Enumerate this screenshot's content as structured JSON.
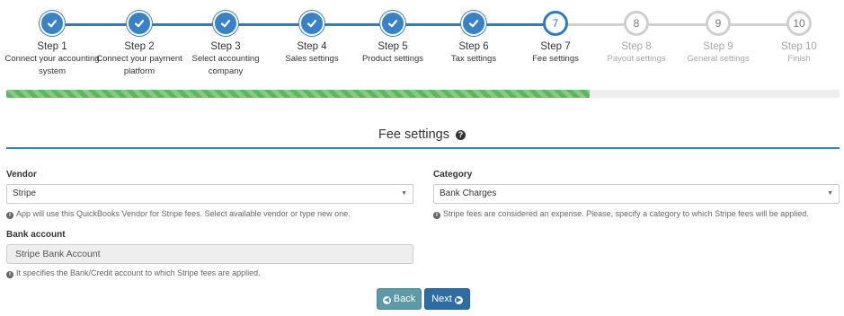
{
  "wizard": {
    "steps": [
      {
        "number": "1",
        "title": "Step 1",
        "desc": "Connect your accounting system",
        "status": "done"
      },
      {
        "number": "2",
        "title": "Step 2",
        "desc": "Connect your payment platform",
        "status": "done"
      },
      {
        "number": "3",
        "title": "Step 3",
        "desc": "Select accounting company",
        "status": "done"
      },
      {
        "number": "4",
        "title": "Step 4",
        "desc": "Sales settings",
        "status": "done"
      },
      {
        "number": "5",
        "title": "Step 5",
        "desc": "Product settings",
        "status": "done"
      },
      {
        "number": "6",
        "title": "Step 6",
        "desc": "Tax settings",
        "status": "done"
      },
      {
        "number": "7",
        "title": "Step 7",
        "desc": "Fee settings",
        "status": "current"
      },
      {
        "number": "8",
        "title": "Step 8",
        "desc": "Payout settings",
        "status": "future"
      },
      {
        "number": "9",
        "title": "Step 9",
        "desc": "General settings",
        "status": "future"
      },
      {
        "number": "10",
        "title": "Step 10",
        "desc": "Finish",
        "status": "future"
      }
    ],
    "progress_fraction": 0.7
  },
  "colors": {
    "accent": "#2f7bbf",
    "progress": "#5cb85c",
    "back_button": "#5b9aa6",
    "next_button": "#2e6da4"
  },
  "section": {
    "title": "Fee settings",
    "help_icon": "question-circle-icon"
  },
  "vendor": {
    "label": "Vendor",
    "value": "Stripe",
    "hint": "App will use this QuickBooks Vendor for Stripe fees. Select available vendor or type new one."
  },
  "category": {
    "label": "Category",
    "value": "Bank Charges",
    "hint": "Stripe fees are considered an expense. Please, specify a category to which Stripe fees will be applied."
  },
  "bank_account": {
    "label": "Bank account",
    "value": "Stripe Bank Account",
    "hint": "It specifies the Bank/Credit account to which Stripe fees are applied."
  },
  "buttons": {
    "back_label": "Back",
    "next_label": "Next"
  }
}
